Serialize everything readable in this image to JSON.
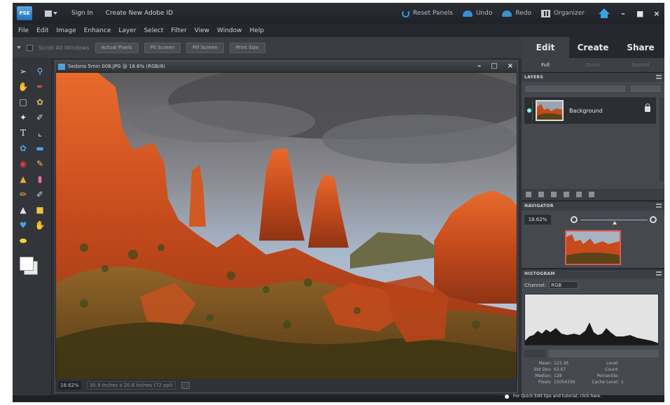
{
  "app": {
    "logo": "PSE",
    "sign_in": "Sign In",
    "create_id": "Create New Adobe ID",
    "reset_panels": "Reset Panels",
    "undo": "Undo",
    "redo": "Redo",
    "organizer": "Organizer"
  },
  "menu": [
    "File",
    "Edit",
    "Image",
    "Enhance",
    "Layer",
    "Select",
    "Filter",
    "View",
    "Window",
    "Help"
  ],
  "options": {
    "scroll_all": "Scroll All Windows",
    "buttons": [
      "Actual Pixels",
      "Fit Screen",
      "Fill Screen",
      "Print Size"
    ]
  },
  "document": {
    "title": "Sedona 5min 008.JPG @ 18.6% (RGB/8)",
    "zoom": "18.62%",
    "doc_info": "30.9 inches x 20.6 inches (72 ppi)"
  },
  "panel": {
    "mode_tabs": [
      "Edit",
      "Create",
      "Share"
    ],
    "sub_tabs": [
      "Full",
      "Quick",
      "Guided"
    ],
    "layers_title": "LAYERS",
    "layer_name": "Background",
    "navigator_title": "NAVIGATOR",
    "nav_zoom": "18.62%",
    "histogram_title": "HISTOGRAM",
    "channel_label": "Channel:",
    "channel_value": "RGB"
  },
  "histogram_stats": [
    {
      "k": "Mean:",
      "v": "123.36",
      "k2": "Level:",
      "v2": ""
    },
    {
      "k": "Std Dev:",
      "v": "63.67",
      "k2": "Count:",
      "v2": ""
    },
    {
      "k": "Median:",
      "v": "128",
      "k2": "Percentile:",
      "v2": ""
    },
    {
      "k": "Pixels:",
      "v": "15054336",
      "k2": "Cache Level:",
      "v2": "1"
    }
  ],
  "tip": "For Quick Edit tips and tutorial, click here.",
  "colors": {
    "accent_blue": "#2f9be3",
    "nav_box": "#e05a4a",
    "rock": "#c4471c"
  },
  "tools": [
    "move-icon",
    "zoom-icon",
    "hand-icon",
    "eyedropper-icon",
    "marquee-icon",
    "lasso-icon",
    "magic-wand-icon",
    "quick-selection-icon",
    "type-icon",
    "crop-icon",
    "cookie-cutter-icon",
    "straighten-icon",
    "red-eye-icon",
    "spot-healing-icon",
    "clone-stamp-icon",
    "eraser-icon",
    "brush-icon",
    "smart-brush-icon",
    "gradient-icon",
    "paint-bucket-icon",
    "shape-icon",
    "blur-icon",
    "sponge-icon",
    "pencil-icon",
    "color-swatch-icon"
  ]
}
